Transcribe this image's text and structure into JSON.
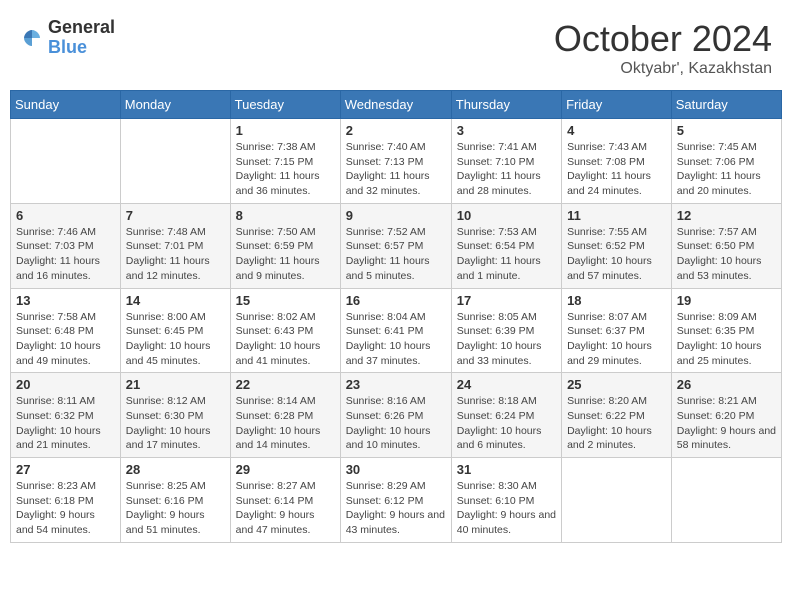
{
  "header": {
    "logo_general": "General",
    "logo_blue": "Blue",
    "month_title": "October 2024",
    "subtitle": "Oktyabr', Kazakhstan"
  },
  "weekdays": [
    "Sunday",
    "Monday",
    "Tuesday",
    "Wednesday",
    "Thursday",
    "Friday",
    "Saturday"
  ],
  "weeks": [
    [
      {
        "day": "",
        "sunrise": "",
        "sunset": "",
        "daylight": ""
      },
      {
        "day": "",
        "sunrise": "",
        "sunset": "",
        "daylight": ""
      },
      {
        "day": "1",
        "sunrise": "Sunrise: 7:38 AM",
        "sunset": "Sunset: 7:15 PM",
        "daylight": "Daylight: 11 hours and 36 minutes."
      },
      {
        "day": "2",
        "sunrise": "Sunrise: 7:40 AM",
        "sunset": "Sunset: 7:13 PM",
        "daylight": "Daylight: 11 hours and 32 minutes."
      },
      {
        "day": "3",
        "sunrise": "Sunrise: 7:41 AM",
        "sunset": "Sunset: 7:10 PM",
        "daylight": "Daylight: 11 hours and 28 minutes."
      },
      {
        "day": "4",
        "sunrise": "Sunrise: 7:43 AM",
        "sunset": "Sunset: 7:08 PM",
        "daylight": "Daylight: 11 hours and 24 minutes."
      },
      {
        "day": "5",
        "sunrise": "Sunrise: 7:45 AM",
        "sunset": "Sunset: 7:06 PM",
        "daylight": "Daylight: 11 hours and 20 minutes."
      }
    ],
    [
      {
        "day": "6",
        "sunrise": "Sunrise: 7:46 AM",
        "sunset": "Sunset: 7:03 PM",
        "daylight": "Daylight: 11 hours and 16 minutes."
      },
      {
        "day": "7",
        "sunrise": "Sunrise: 7:48 AM",
        "sunset": "Sunset: 7:01 PM",
        "daylight": "Daylight: 11 hours and 12 minutes."
      },
      {
        "day": "8",
        "sunrise": "Sunrise: 7:50 AM",
        "sunset": "Sunset: 6:59 PM",
        "daylight": "Daylight: 11 hours and 9 minutes."
      },
      {
        "day": "9",
        "sunrise": "Sunrise: 7:52 AM",
        "sunset": "Sunset: 6:57 PM",
        "daylight": "Daylight: 11 hours and 5 minutes."
      },
      {
        "day": "10",
        "sunrise": "Sunrise: 7:53 AM",
        "sunset": "Sunset: 6:54 PM",
        "daylight": "Daylight: 11 hours and 1 minute."
      },
      {
        "day": "11",
        "sunrise": "Sunrise: 7:55 AM",
        "sunset": "Sunset: 6:52 PM",
        "daylight": "Daylight: 10 hours and 57 minutes."
      },
      {
        "day": "12",
        "sunrise": "Sunrise: 7:57 AM",
        "sunset": "Sunset: 6:50 PM",
        "daylight": "Daylight: 10 hours and 53 minutes."
      }
    ],
    [
      {
        "day": "13",
        "sunrise": "Sunrise: 7:58 AM",
        "sunset": "Sunset: 6:48 PM",
        "daylight": "Daylight: 10 hours and 49 minutes."
      },
      {
        "day": "14",
        "sunrise": "Sunrise: 8:00 AM",
        "sunset": "Sunset: 6:45 PM",
        "daylight": "Daylight: 10 hours and 45 minutes."
      },
      {
        "day": "15",
        "sunrise": "Sunrise: 8:02 AM",
        "sunset": "Sunset: 6:43 PM",
        "daylight": "Daylight: 10 hours and 41 minutes."
      },
      {
        "day": "16",
        "sunrise": "Sunrise: 8:04 AM",
        "sunset": "Sunset: 6:41 PM",
        "daylight": "Daylight: 10 hours and 37 minutes."
      },
      {
        "day": "17",
        "sunrise": "Sunrise: 8:05 AM",
        "sunset": "Sunset: 6:39 PM",
        "daylight": "Daylight: 10 hours and 33 minutes."
      },
      {
        "day": "18",
        "sunrise": "Sunrise: 8:07 AM",
        "sunset": "Sunset: 6:37 PM",
        "daylight": "Daylight: 10 hours and 29 minutes."
      },
      {
        "day": "19",
        "sunrise": "Sunrise: 8:09 AM",
        "sunset": "Sunset: 6:35 PM",
        "daylight": "Daylight: 10 hours and 25 minutes."
      }
    ],
    [
      {
        "day": "20",
        "sunrise": "Sunrise: 8:11 AM",
        "sunset": "Sunset: 6:32 PM",
        "daylight": "Daylight: 10 hours and 21 minutes."
      },
      {
        "day": "21",
        "sunrise": "Sunrise: 8:12 AM",
        "sunset": "Sunset: 6:30 PM",
        "daylight": "Daylight: 10 hours and 17 minutes."
      },
      {
        "day": "22",
        "sunrise": "Sunrise: 8:14 AM",
        "sunset": "Sunset: 6:28 PM",
        "daylight": "Daylight: 10 hours and 14 minutes."
      },
      {
        "day": "23",
        "sunrise": "Sunrise: 8:16 AM",
        "sunset": "Sunset: 6:26 PM",
        "daylight": "Daylight: 10 hours and 10 minutes."
      },
      {
        "day": "24",
        "sunrise": "Sunrise: 8:18 AM",
        "sunset": "Sunset: 6:24 PM",
        "daylight": "Daylight: 10 hours and 6 minutes."
      },
      {
        "day": "25",
        "sunrise": "Sunrise: 8:20 AM",
        "sunset": "Sunset: 6:22 PM",
        "daylight": "Daylight: 10 hours and 2 minutes."
      },
      {
        "day": "26",
        "sunrise": "Sunrise: 8:21 AM",
        "sunset": "Sunset: 6:20 PM",
        "daylight": "Daylight: 9 hours and 58 minutes."
      }
    ],
    [
      {
        "day": "27",
        "sunrise": "Sunrise: 8:23 AM",
        "sunset": "Sunset: 6:18 PM",
        "daylight": "Daylight: 9 hours and 54 minutes."
      },
      {
        "day": "28",
        "sunrise": "Sunrise: 8:25 AM",
        "sunset": "Sunset: 6:16 PM",
        "daylight": "Daylight: 9 hours and 51 minutes."
      },
      {
        "day": "29",
        "sunrise": "Sunrise: 8:27 AM",
        "sunset": "Sunset: 6:14 PM",
        "daylight": "Daylight: 9 hours and 47 minutes."
      },
      {
        "day": "30",
        "sunrise": "Sunrise: 8:29 AM",
        "sunset": "Sunset: 6:12 PM",
        "daylight": "Daylight: 9 hours and 43 minutes."
      },
      {
        "day": "31",
        "sunrise": "Sunrise: 8:30 AM",
        "sunset": "Sunset: 6:10 PM",
        "daylight": "Daylight: 9 hours and 40 minutes."
      },
      {
        "day": "",
        "sunrise": "",
        "sunset": "",
        "daylight": ""
      },
      {
        "day": "",
        "sunrise": "",
        "sunset": "",
        "daylight": ""
      }
    ]
  ]
}
